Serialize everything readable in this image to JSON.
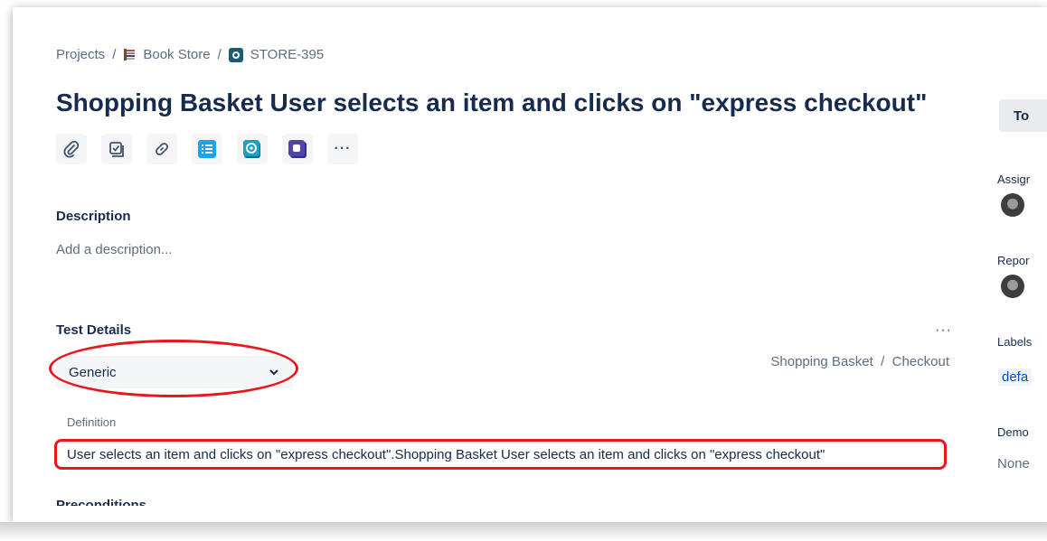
{
  "breadcrumb": {
    "projects": "Projects",
    "sep1": "/",
    "project": "Book Store",
    "sep2": "/",
    "issue_key": "STORE-395"
  },
  "issue": {
    "title": "Shopping Basket User selects an item and clicks on \"express checkout\""
  },
  "toolbar": {
    "icons": [
      "paperclip-icon",
      "checklist-icon",
      "link-icon",
      "list-app-icon",
      "xray-app-icon",
      "app-icon",
      "more-icon"
    ],
    "more_label": "···"
  },
  "description": {
    "label": "Description",
    "placeholder": "Add a description..."
  },
  "test_details": {
    "label": "Test Details",
    "more_label": "···",
    "test_type": "Generic",
    "repository_path": "Shopping Basket  /  Checkout",
    "definition_label": "Definition",
    "definition_value": "User selects an item and clicks on \"express checkout\".Shopping Basket User selects an item and clicks on \"express checkout\"",
    "preconditions_label": "Preconditions"
  },
  "sidebar": {
    "status_button": "To",
    "assignee_label": "Assigr",
    "reporter_label": "Repor",
    "labels_label": "Labels",
    "label_tag": "defa",
    "demo_label": "Demo",
    "demo_value": "None"
  },
  "colors": {
    "annotation_red": "#e8171b",
    "link_blue": "#0052cc",
    "text_primary": "#172b4d",
    "text_secondary": "#5e6c84"
  }
}
